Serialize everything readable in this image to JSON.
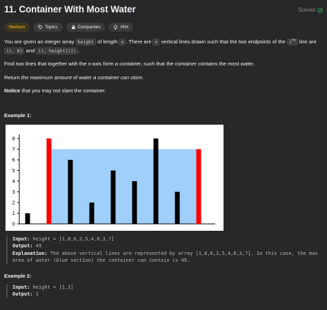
{
  "problem": {
    "title": "11. Container With Most Water",
    "status": "Solved",
    "tags": {
      "difficulty": "Medium",
      "topics": "Topics",
      "companies": "Companies",
      "hint": "Hint"
    }
  },
  "description": {
    "p1_a": "You are given an integer array ",
    "p1_code1": "height",
    "p1_b": " of length ",
    "p1_code2": "n",
    "p1_c": ". There are ",
    "p1_code3": "n",
    "p1_d": " vertical lines drawn such that the two endpoints of the ",
    "p1_code4": "i",
    "p1_sup": "th",
    "p1_e": " line are ",
    "p1_code5": "(i, 0)",
    "p1_f": " and ",
    "p1_code6": "(i, height[i])",
    "p1_g": ".",
    "p2": "Find two lines that together with the x-axis form a container, such that the container contains the most water.",
    "p3_a": "Return ",
    "p3_em": "the maximum amount of water a container can store",
    "p3_b": ".",
    "p4_strong": "Notice",
    "p4_rest": " that you may not slant the container."
  },
  "example1": {
    "title": "Example 1:",
    "input_label": "Input:",
    "input_value": "height = [1,8,6,2,5,4,8,3,7]",
    "output_label": "Output:",
    "output_value": "49",
    "explanation_label": "Explanation:",
    "explanation_value": "The above vertical lines are represented by array [1,8,6,2,5,4,8,3,7]. In this case, the max area of water (blue section) the container can contain is 49."
  },
  "example2": {
    "title": "Example 2:",
    "input_label": "Input:",
    "input_value": "height = [1,1]",
    "output_label": "Output:",
    "output_value": "1"
  },
  "chart_data": {
    "type": "bar",
    "values": [
      1,
      8,
      6,
      2,
      5,
      4,
      8,
      3,
      7
    ],
    "y_ticks": [
      "0",
      "1",
      "2",
      "3",
      "4",
      "5",
      "6",
      "7",
      "8"
    ],
    "ylim": [
      0,
      8
    ],
    "highlight_indices": [
      1,
      8
    ],
    "water_level": 7,
    "colors": {
      "bar": "#000000",
      "highlight": "#ff0000",
      "water": "#9fcffb",
      "axis": "#000000"
    }
  },
  "colors": {
    "background": "#282828",
    "medium": "#ffb800",
    "solved_icon": "#2cbb5d",
    "tag_bg": "#3a3a3a"
  }
}
